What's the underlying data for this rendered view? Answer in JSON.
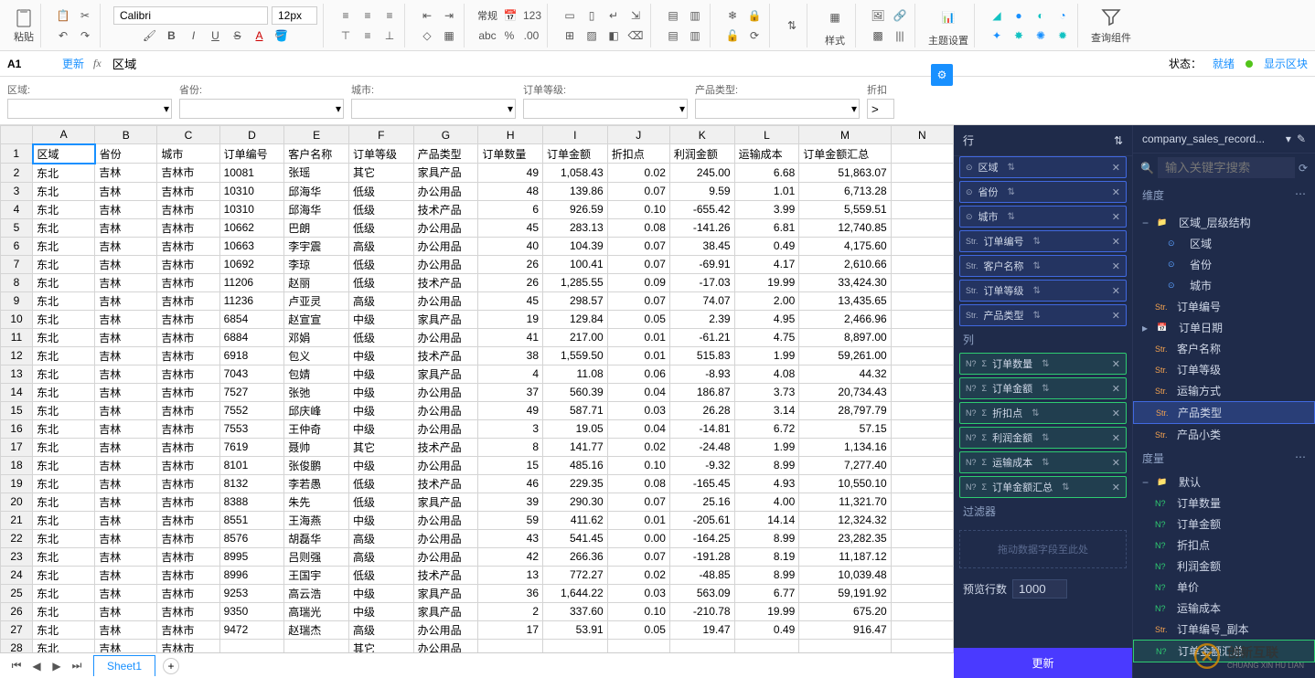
{
  "toolbar": {
    "paste": "粘贴",
    "font": "Calibri",
    "size": "12px",
    "format_label": "常规",
    "style_label": "样式",
    "theme_label": "主题设置",
    "query_label": "查询组件"
  },
  "formula_bar": {
    "cell": "A1",
    "update": "更新",
    "fx": "fx",
    "value": "区域",
    "status_label": "状态：",
    "status_value": "就绪",
    "display_block": "显示区块"
  },
  "filters": [
    {
      "label": "区域:"
    },
    {
      "label": "省份:"
    },
    {
      "label": "城市:"
    },
    {
      "label": "订单等级:"
    },
    {
      "label": "产品类型:"
    },
    {
      "label": "折扣",
      "op": ">"
    }
  ],
  "columns": [
    "A",
    "B",
    "C",
    "D",
    "E",
    "F",
    "G",
    "H",
    "I",
    "J",
    "K",
    "L",
    "M",
    "N"
  ],
  "headers": [
    "区域",
    "省份",
    "城市",
    "订单编号",
    "客户名称",
    "订单等级",
    "产品类型",
    "订单数量",
    "订单金额",
    "折扣点",
    "利润金额",
    "运输成本",
    "订单金额汇总"
  ],
  "rows": [
    [
      "东北",
      "吉林",
      "吉林市",
      "10081",
      "张瑶",
      "其它",
      "家具产品",
      "49",
      "1,058.43",
      "0.02",
      "245.00",
      "6.68",
      "51,863.07"
    ],
    [
      "东北",
      "吉林",
      "吉林市",
      "10310",
      "邱海华",
      "低级",
      "办公用品",
      "48",
      "139.86",
      "0.07",
      "9.59",
      "1.01",
      "6,713.28"
    ],
    [
      "东北",
      "吉林",
      "吉林市",
      "10310",
      "邱海华",
      "低级",
      "技术产品",
      "6",
      "926.59",
      "0.10",
      "-655.42",
      "3.99",
      "5,559.51"
    ],
    [
      "东北",
      "吉林",
      "吉林市",
      "10662",
      "巴朗",
      "低级",
      "办公用品",
      "45",
      "283.13",
      "0.08",
      "-141.26",
      "6.81",
      "12,740.85"
    ],
    [
      "东北",
      "吉林",
      "吉林市",
      "10663",
      "李宇震",
      "高级",
      "办公用品",
      "40",
      "104.39",
      "0.07",
      "38.45",
      "0.49",
      "4,175.60"
    ],
    [
      "东北",
      "吉林",
      "吉林市",
      "10692",
      "李琼",
      "低级",
      "办公用品",
      "26",
      "100.41",
      "0.07",
      "-69.91",
      "4.17",
      "2,610.66"
    ],
    [
      "东北",
      "吉林",
      "吉林市",
      "11206",
      "赵丽",
      "低级",
      "技术产品",
      "26",
      "1,285.55",
      "0.09",
      "-17.03",
      "19.99",
      "33,424.30"
    ],
    [
      "东北",
      "吉林",
      "吉林市",
      "11236",
      "卢亚灵",
      "高级",
      "办公用品",
      "45",
      "298.57",
      "0.07",
      "74.07",
      "2.00",
      "13,435.65"
    ],
    [
      "东北",
      "吉林",
      "吉林市",
      "6854",
      "赵宣宣",
      "中级",
      "家具产品",
      "19",
      "129.84",
      "0.05",
      "2.39",
      "4.95",
      "2,466.96"
    ],
    [
      "东北",
      "吉林",
      "吉林市",
      "6884",
      "邓娟",
      "低级",
      "办公用品",
      "41",
      "217.00",
      "0.01",
      "-61.21",
      "4.75",
      "8,897.00"
    ],
    [
      "东北",
      "吉林",
      "吉林市",
      "6918",
      "包义",
      "中级",
      "技术产品",
      "38",
      "1,559.50",
      "0.01",
      "515.83",
      "1.99",
      "59,261.00"
    ],
    [
      "东北",
      "吉林",
      "吉林市",
      "7043",
      "包婧",
      "中级",
      "家具产品",
      "4",
      "11.08",
      "0.06",
      "-8.93",
      "4.08",
      "44.32"
    ],
    [
      "东北",
      "吉林",
      "吉林市",
      "7527",
      "张弛",
      "中级",
      "办公用品",
      "37",
      "560.39",
      "0.04",
      "186.87",
      "3.73",
      "20,734.43"
    ],
    [
      "东北",
      "吉林",
      "吉林市",
      "7552",
      "邱庆峰",
      "中级",
      "办公用品",
      "49",
      "587.71",
      "0.03",
      "26.28",
      "3.14",
      "28,797.79"
    ],
    [
      "东北",
      "吉林",
      "吉林市",
      "7553",
      "王仲奇",
      "中级",
      "办公用品",
      "3",
      "19.05",
      "0.04",
      "-14.81",
      "6.72",
      "57.15"
    ],
    [
      "东北",
      "吉林",
      "吉林市",
      "7619",
      "聂帅",
      "其它",
      "技术产品",
      "8",
      "141.77",
      "0.02",
      "-24.48",
      "1.99",
      "1,134.16"
    ],
    [
      "东北",
      "吉林",
      "吉林市",
      "8101",
      "张俊鹏",
      "中级",
      "办公用品",
      "15",
      "485.16",
      "0.10",
      "-9.32",
      "8.99",
      "7,277.40"
    ],
    [
      "东北",
      "吉林",
      "吉林市",
      "8132",
      "李若愚",
      "低级",
      "技术产品",
      "46",
      "229.35",
      "0.08",
      "-165.45",
      "4.93",
      "10,550.10"
    ],
    [
      "东北",
      "吉林",
      "吉林市",
      "8388",
      "朱先",
      "低级",
      "家具产品",
      "39",
      "290.30",
      "0.07",
      "25.16",
      "4.00",
      "11,321.70"
    ],
    [
      "东北",
      "吉林",
      "吉林市",
      "8551",
      "王海燕",
      "中级",
      "办公用品",
      "59",
      "411.62",
      "0.01",
      "-205.61",
      "14.14",
      "12,324.32"
    ],
    [
      "东北",
      "吉林",
      "吉林市",
      "8576",
      "胡磊华",
      "高级",
      "办公用品",
      "43",
      "541.45",
      "0.00",
      "-164.25",
      "8.99",
      "23,282.35"
    ],
    [
      "东北",
      "吉林",
      "吉林市",
      "8995",
      "吕则强",
      "高级",
      "办公用品",
      "42",
      "266.36",
      "0.07",
      "-191.28",
      "8.19",
      "11,187.12"
    ],
    [
      "东北",
      "吉林",
      "吉林市",
      "8996",
      "王国宇",
      "低级",
      "技术产品",
      "13",
      "772.27",
      "0.02",
      "-48.85",
      "8.99",
      "10,039.48"
    ],
    [
      "东北",
      "吉林",
      "吉林市",
      "9253",
      "高云浩",
      "中级",
      "家具产品",
      "36",
      "1,644.22",
      "0.03",
      "563.09",
      "6.77",
      "59,191.92"
    ],
    [
      "东北",
      "吉林",
      "吉林市",
      "9350",
      "高瑞光",
      "中级",
      "家具产品",
      "2",
      "337.60",
      "0.10",
      "-210.78",
      "19.99",
      "675.20"
    ],
    [
      "东北",
      "吉林",
      "吉林市",
      "9472",
      "赵瑞杰",
      "高级",
      "办公用品",
      "17",
      "53.91",
      "0.05",
      "19.47",
      "0.49",
      "916.47"
    ],
    [
      "东北",
      "吉林",
      "吉林市",
      "",
      "",
      "其它",
      "办公用品",
      "",
      "",
      "",
      "",
      "",
      ""
    ]
  ],
  "sheet_tab": "Sheet1",
  "config_panel": {
    "row_title": "行",
    "row_chips": [
      "区域",
      "省份",
      "城市",
      "订单编号",
      "客户名称",
      "订单等级",
      "产品类型"
    ],
    "col_title": "列",
    "col_chips": [
      "订单数量",
      "订单金额",
      "折扣点",
      "利润金额",
      "运输成本",
      "订单金额汇总"
    ],
    "filter_title": "过滤器",
    "drop_hint": "拖动数据字段至此处",
    "preview_label": "预览行数",
    "preview_value": "1000",
    "update_btn": "更新"
  },
  "fields_panel": {
    "dataset": "company_sales_record...",
    "search_placeholder": "输入关键字搜索",
    "dim_title": "维度",
    "dim_tree": {
      "group": "区域_层级结构",
      "children": [
        "区域",
        "省份",
        "城市"
      ]
    },
    "dim_items": [
      "订单编号",
      "订单日期",
      "客户名称",
      "订单等级",
      "运输方式",
      "产品类型",
      "产品小类"
    ],
    "metric_title": "度量",
    "metric_group": "默认",
    "metric_items": [
      "订单数量",
      "订单金额",
      "折扣点",
      "利润金额",
      "单价",
      "运输成本",
      "订单编号_副本",
      "订单金额汇总"
    ]
  },
  "watermark": {
    "brand": "创新互联",
    "sub": "CHUANG XIN HU LIAN"
  }
}
